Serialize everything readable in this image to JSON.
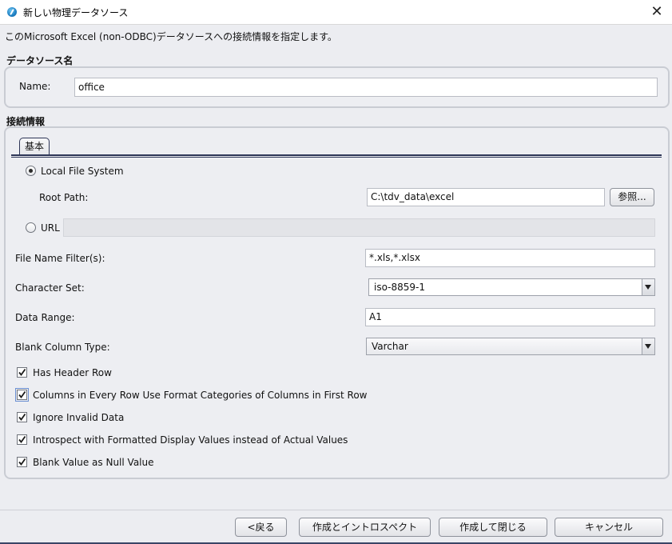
{
  "window": {
    "title": "新しい物理データソース",
    "app_icon": "app-icon",
    "close_icon": "close-icon",
    "close_glyph": "✕"
  },
  "description": "このMicrosoft Excel (non-ODBC)データソースへの接続情報を指定します。",
  "datasource_section": {
    "label": "データソース名",
    "name_label": "Name:",
    "name_value": "office"
  },
  "connection_section": {
    "label": "接続情報",
    "tab_label": "基本",
    "local_fs": {
      "label": "Local File System",
      "selected": true
    },
    "root_path": {
      "label": "Root Path:",
      "value": "C:\\tdv_data\\excel",
      "browse_label": "参照..."
    },
    "url": {
      "label": "URL",
      "selected": false,
      "value": ""
    },
    "file_filter": {
      "label": "File Name Filter(s):",
      "value": "*.xls,*.xlsx"
    },
    "charset": {
      "label": "Character Set:",
      "value": "iso-8859-1"
    },
    "data_range": {
      "label": "Data Range:",
      "value": "A1"
    },
    "blank_col_type": {
      "label": "Blank Column Type:",
      "value": "Varchar"
    },
    "checkboxes": [
      {
        "label": "Has Header Row",
        "checked": true
      },
      {
        "label": "Columns in Every Row Use Format Categories of Columns in First Row",
        "checked": true
      },
      {
        "label": "Ignore Invalid Data",
        "checked": true
      },
      {
        "label": "Introspect with Formatted Display Values instead of Actual Values",
        "checked": true
      },
      {
        "label": "Blank Value as Null Value",
        "checked": true
      }
    ]
  },
  "footer": {
    "back_label": "<戻る",
    "create_introspect_label": "作成とイントロスペクト",
    "create_close_label": "作成して閉じる",
    "cancel_label": "キャンセル"
  },
  "colors": {
    "accent": "#2d3556",
    "background": "#ecedf1"
  }
}
